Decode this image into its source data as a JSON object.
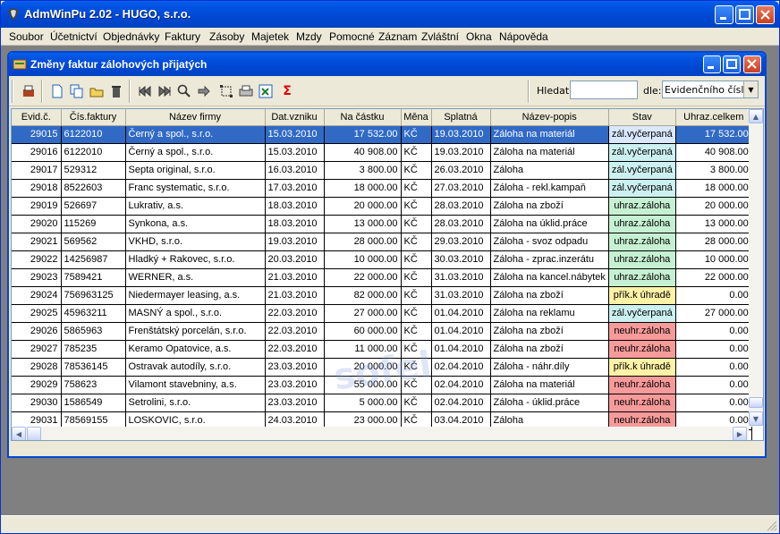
{
  "app": {
    "title": "AdmWinPu 2.02 - HUGO, s.r.o."
  },
  "menu": [
    "Soubor",
    "Účetnictví",
    "Objednávky",
    "Faktury",
    "Zásoby",
    "Majetek",
    "Mzdy",
    "Pomocné",
    "Záznam",
    "Zvláštní",
    "Okna",
    "Nápověda"
  ],
  "child": {
    "title": "Změny faktur zálohových přijatých"
  },
  "toolbar": {
    "icons": [
      "print-preview-icon",
      "new-doc-icon",
      "copy-icon",
      "open-icon",
      "delete-icon",
      "first-record-icon",
      "last-record-icon",
      "search-icon",
      "next-icon",
      "select-icon",
      "print-icon",
      "export-icon",
      "sum-icon"
    ],
    "search_label": "Hledat:",
    "search_value": "",
    "by_label": "dle:",
    "by_value": "Evidenčního čísla"
  },
  "table": {
    "columns": [
      "Evid.č.",
      "Čís.faktury",
      "Název firmy",
      "Dat.vzniku",
      "Na částku",
      "Měna",
      "Splatná",
      "Název-popis",
      "Stav",
      "Uhraz.celkem"
    ],
    "rows": [
      [
        "29015",
        "6122010",
        "Černý a spol., s.r.o.",
        "15.03.2010",
        "17 532.00",
        "KČ",
        "19.03.2010",
        "Záloha na materiál",
        "zál.vyčerpaná",
        "17 532.00"
      ],
      [
        "29016",
        "6122010",
        "Černý a spol., s.r.o.",
        "15.03.2010",
        "40 908.00",
        "KČ",
        "19.03.2010",
        "Záloha na materiál",
        "zál.vyčerpaná",
        "40 908.00"
      ],
      [
        "29017",
        "529312",
        "Septa original, s.r.o.",
        "16.03.2010",
        "3 800.00",
        "KČ",
        "26.03.2010",
        "Záloha",
        "zál.vyčerpaná",
        "3 800.00"
      ],
      [
        "29018",
        "8522603",
        "Franc systematic, s.r.o.",
        "17.03.2010",
        "18 000.00",
        "KČ",
        "27.03.2010",
        "Záloha - rekl.kampaň",
        "zál.vyčerpaná",
        "18 000.00"
      ],
      [
        "29019",
        "526697",
        "Lukrativ, a.s.",
        "18.03.2010",
        "20 000.00",
        "KČ",
        "28.03.2010",
        "Záloha na zboží",
        "uhraz.záloha",
        "20 000.00"
      ],
      [
        "29020",
        "115269",
        "Synkona, a.s.",
        "18.03.2010",
        "13 000.00",
        "KČ",
        "28.03.2010",
        "Záloha na úklid.práce",
        "uhraz.záloha",
        "13 000.00"
      ],
      [
        "29021",
        "569562",
        "VKHD, s.r.o.",
        "19.03.2010",
        "28 000.00",
        "KČ",
        "29.03.2010",
        "Záloha - svoz odpadu",
        "uhraz.záloha",
        "28 000.00"
      ],
      [
        "29022",
        "14256987",
        "Hladký + Rakovec, s.r.o.",
        "20.03.2010",
        "10 000.00",
        "KČ",
        "30.03.2010",
        "Záloha - zprac.inzerátu",
        "uhraz.záloha",
        "10 000.00"
      ],
      [
        "29023",
        "7589421",
        "WERNER, a.s.",
        "21.03.2010",
        "22 000.00",
        "KČ",
        "31.03.2010",
        "Záloha na kancel.nábytek",
        "uhraz.záloha",
        "22 000.00"
      ],
      [
        "29024",
        "756963125",
        "Niedermayer leasing, a.s.",
        "21.03.2010",
        "82 000.00",
        "KČ",
        "31.03.2010",
        "Záloha na zboží",
        "přík.k úhradě",
        "0.00"
      ],
      [
        "29025",
        "45963211",
        "MASNÝ a spol., s.r.o.",
        "22.03.2010",
        "27 000.00",
        "KČ",
        "01.04.2010",
        "Záloha na reklamu",
        "zál.vyčerpaná",
        "27 000.00"
      ],
      [
        "29026",
        "5865963",
        "Frenštátský porcelán, s.r.o.",
        "22.03.2010",
        "60 000.00",
        "KČ",
        "01.04.2010",
        "Záloha na zboží",
        "neuhr.záloha",
        "0.00"
      ],
      [
        "29027",
        "785235",
        "Keramo Opatovice, a.s.",
        "22.03.2010",
        "11 000.00",
        "KČ",
        "01.04.2010",
        "Záloha na zboží",
        "neuhr.záloha",
        "0.00"
      ],
      [
        "29028",
        "78536145",
        "Ostravak autodíly, s.r.o.",
        "23.03.2010",
        "20 000.00",
        "KČ",
        "02.04.2010",
        "Záloha - náhr.díly",
        "přík.k úhradě",
        "0.00"
      ],
      [
        "29029",
        "758623",
        "Vilamont stavebniny, a.s.",
        "23.03.2010",
        "55 000.00",
        "KČ",
        "02.04.2010",
        "Záloha na materiál",
        "neuhr.záloha",
        "0.00"
      ],
      [
        "29030",
        "1586549",
        "Setrolini, s.r.o.",
        "23.03.2010",
        "5 000.00",
        "KČ",
        "02.04.2010",
        "Záloha - úklid.práce",
        "neuhr.záloha",
        "0.00"
      ],
      [
        "29031",
        "78569155",
        "LOSKOVIC, s.r.o.",
        "24.03.2010",
        "23 000.00",
        "KČ",
        "03.04.2010",
        "Záloha",
        "neuhr.záloha",
        "0.00"
      ]
    ],
    "selected_row": 0
  },
  "watermark": "sofel",
  "colors": {
    "selected": "#316ac5",
    "zal": "#ccf0f0",
    "uhraz": "#c6f0d2",
    "neuhr": "#f79a9a",
    "prik": "#fdf2a6"
  }
}
